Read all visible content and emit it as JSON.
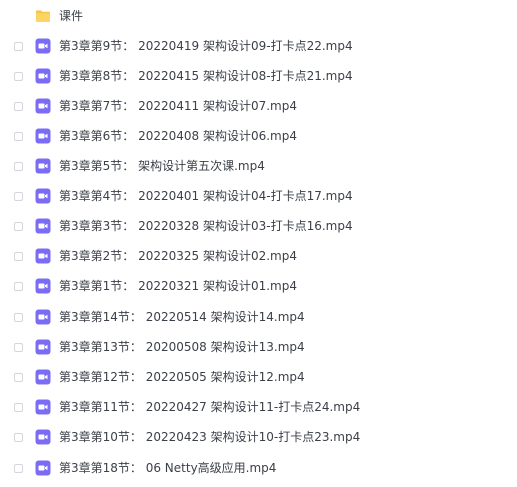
{
  "colors": {
    "folder": "#f7c64a",
    "video_icon": "#7b6cf6",
    "text": "#3b3f47"
  },
  "folder": {
    "icon": "folder-icon",
    "name": "课件"
  },
  "files": [
    {
      "icon": "video-file-icon",
      "name": "第3章第9节： 20220419 架构设计09-打卡点22.mp4"
    },
    {
      "icon": "video-file-icon",
      "name": "第3章第8节： 20220415 架构设计08-打卡点21.mp4"
    },
    {
      "icon": "video-file-icon",
      "name": "第3章第7节： 20220411 架构设计07.mp4"
    },
    {
      "icon": "video-file-icon",
      "name": "第3章第6节： 20220408 架构设计06.mp4"
    },
    {
      "icon": "video-file-icon",
      "name": "第3章第5节： 架构设计第五次课.mp4"
    },
    {
      "icon": "video-file-icon",
      "name": "第3章第4节： 20220401 架构设计04-打卡点17.mp4"
    },
    {
      "icon": "video-file-icon",
      "name": "第3章第3节： 20220328 架构设计03-打卡点16.mp4"
    },
    {
      "icon": "video-file-icon",
      "name": "第3章第2节： 20220325 架构设计02.mp4"
    },
    {
      "icon": "video-file-icon",
      "name": "第3章第1节： 20220321 架构设计01.mp4"
    },
    {
      "icon": "video-file-icon",
      "name": "第3章第14节： 20220514 架构设计14.mp4"
    },
    {
      "icon": "video-file-icon",
      "name": "第3章第13节： 20200508 架构设计13.mp4"
    },
    {
      "icon": "video-file-icon",
      "name": "第3章第12节： 20220505 架构设计12.mp4"
    },
    {
      "icon": "video-file-icon",
      "name": "第3章第11节： 20220427 架构设计11-打卡点24.mp4"
    },
    {
      "icon": "video-file-icon",
      "name": "第3章第10节： 20220423 架构设计10-打卡点23.mp4"
    },
    {
      "icon": "video-file-icon",
      "name": "第3章第18节： 06 Netty高级应用.mp4"
    }
  ]
}
